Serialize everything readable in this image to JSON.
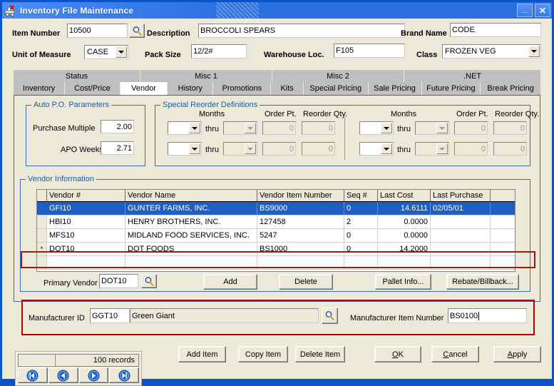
{
  "window": {
    "title": "Inventory File Maintenance",
    "icon": "inventory-cart-icon",
    "minimize_label": "_",
    "close_label": "✕",
    "accent_blue": "#0a54c8",
    "title_gradient_from": "#4f8ef7",
    "title_gradient_to": "#2b6fe0",
    "face_color": "#ece9d8",
    "highlight_red": "#b00000",
    "grid_selection_blue": "#1f5fc4",
    "group_label_blue": "#1b5fa8"
  },
  "header": {
    "item_number_label": "Item Number",
    "item_number_value": "10500",
    "item_number_lookup_icon": "magnifier-icon",
    "description_label": "Description",
    "description_value": "BROCCOLI SPEARS",
    "brand_name_label": "Brand Name",
    "brand_name_value": "CODE",
    "unit_of_measure_label": "Unit of Measure",
    "unit_of_measure_value": "CASE",
    "pack_size_label": "Pack Size",
    "pack_size_value": "12/2#",
    "warehouse_loc_label": "Warehouse Loc.",
    "warehouse_loc_value": "F105",
    "class_label": "Class",
    "class_value": "FROZEN VEG"
  },
  "group_tabs": [
    {
      "label": "Status"
    },
    {
      "label": "Misc 1"
    },
    {
      "label": "Misc 2"
    },
    {
      "label": ".NET"
    }
  ],
  "tabs": [
    {
      "label": "Inventory",
      "selected": false
    },
    {
      "label": "Cost/Price",
      "selected": false
    },
    {
      "label": "Vendor",
      "selected": true
    },
    {
      "label": "History",
      "selected": false
    },
    {
      "label": "Promotions",
      "selected": false
    },
    {
      "label": "Kits",
      "selected": false
    },
    {
      "label": "Special Pricing",
      "selected": false
    },
    {
      "label": "Sale Pricing",
      "selected": false
    },
    {
      "label": "Future Pricing",
      "selected": false
    },
    {
      "label": "Break Pricing",
      "selected": false
    }
  ],
  "auto_po": {
    "title": "Auto P.O. Parameters",
    "purchase_multiple_label": "Purchase Multiple",
    "purchase_multiple_value": "2.00",
    "apo_weeks_label": "APO Weeks",
    "apo_weeks_value": "2.71"
  },
  "special_reorder": {
    "title": "Special Reorder Definitions",
    "months_label_left": "Months",
    "order_pt_label_left": "Order Pt.",
    "reorder_qty_label_left": "Reorder Qty.",
    "months_label_right": "Months",
    "order_pt_label_right": "Order Pt.",
    "reorder_qty_label_right": "Reorder Qty.",
    "thru_label": "thru",
    "rows_left": [
      {
        "month_from": "",
        "month_to": "",
        "order_pt": "0",
        "reorder_qty": "0"
      },
      {
        "month_from": "",
        "month_to": "",
        "order_pt": "0",
        "reorder_qty": "0"
      }
    ],
    "rows_right": [
      {
        "month_from": "",
        "month_to": "",
        "order_pt": "0",
        "reorder_qty": "0"
      },
      {
        "month_from": "",
        "month_to": "",
        "order_pt": "0",
        "reorder_qty": "0"
      }
    ]
  },
  "vendor_information": {
    "title": "Vendor Information",
    "columns": [
      "Vendor #",
      "Vendor Name",
      "Vendor Item Number",
      "Seq #",
      "Last Cost",
      "Last Purchase"
    ],
    "rows": [
      {
        "marker": "",
        "vendor_no": "GFI10",
        "vendor_name": "GUNTER FARMS, INC.",
        "vendor_item_number": "BS9000",
        "seq_no": "0",
        "last_cost": "14.6111",
        "last_purchase": "02/05/01",
        "selected": true,
        "highlighted": false
      },
      {
        "marker": "",
        "vendor_no": "HBI10",
        "vendor_name": "HENRY BROTHERS, INC.",
        "vendor_item_number": "127458",
        "seq_no": "2",
        "last_cost": "0.0000",
        "last_purchase": "",
        "selected": false,
        "highlighted": false
      },
      {
        "marker": "",
        "vendor_no": "MFS10",
        "vendor_name": "MIDLAND FOOD SERVICES, INC.",
        "vendor_item_number": "5247",
        "seq_no": "0",
        "last_cost": "0.0000",
        "last_purchase": "",
        "selected": false,
        "highlighted": false
      },
      {
        "marker": "*",
        "vendor_no": "DOT10",
        "vendor_name": "DOT FOODS",
        "vendor_item_number": "BS1000",
        "seq_no": "0",
        "last_cost": "14.2000",
        "last_purchase": "",
        "selected": false,
        "highlighted": true
      },
      {
        "marker": "",
        "vendor_no": "",
        "vendor_name": "",
        "vendor_item_number": "",
        "seq_no": "",
        "last_cost": "",
        "last_purchase": "",
        "selected": false,
        "highlighted": false
      }
    ],
    "primary_vendor_label": "Primary Vendor",
    "primary_vendor_value": "DOT10",
    "primary_vendor_lookup_icon": "magnifier-icon",
    "add_button": "Add",
    "delete_button": "Delete",
    "pallet_info_button": "Pallet Info...",
    "rebate_billback_button": "Rebate/Billback..."
  },
  "manufacturer": {
    "id_label": "Manufacturer ID",
    "id_value": "GGT10",
    "name_value": "Green Giant",
    "lookup_icon": "magnifier-icon",
    "item_number_label": "Manufacturer Item Number",
    "item_number_value": "BS0100"
  },
  "footer": {
    "record_count": "100 records",
    "nav_first_icon": "first-record-icon",
    "nav_prev_icon": "previous-record-icon",
    "nav_next_icon": "next-record-icon",
    "nav_last_icon": "last-record-icon",
    "add_item_button": "Add Item",
    "copy_item_button": "Copy Item",
    "delete_item_button": "Delete Item",
    "ok_button": "OK",
    "ok_accel": "O",
    "cancel_button": "Cancel",
    "cancel_accel": "C",
    "apply_button": "Apply",
    "apply_accel": "A"
  }
}
